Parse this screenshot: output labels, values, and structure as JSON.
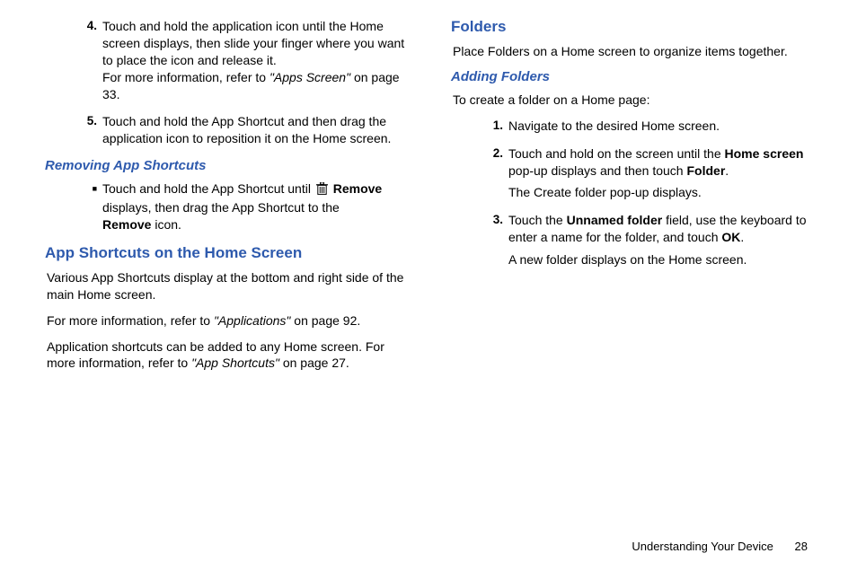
{
  "left": {
    "items45": [
      {
        "num": "4.",
        "body_a": "Touch and hold the application icon until the Home screen displays, then slide your finger where you want to place the icon and release it.",
        "body_b_pre": "For more information, refer to ",
        "body_b_ref": "\"Apps Screen\"",
        "body_b_post": " on page 33."
      },
      {
        "num": "5.",
        "body_a": "Touch and hold the App Shortcut and then drag the application icon to reposition it on the Home screen."
      }
    ],
    "h_removing": "Removing App Shortcuts",
    "remove_item": {
      "pre": "Touch and hold the App Shortcut until ",
      "remove_label": "Remove",
      "mid": " displays, then drag the App Shortcut to the ",
      "remove_icon_label": "Remove",
      "post": " icon."
    },
    "h_appshort": "App Shortcuts on the Home Screen",
    "p1": "Various App Shortcuts display at the bottom and right side of the main Home screen.",
    "p2_pre": "For more information, refer to ",
    "p2_ref": "\"Applications\"",
    "p2_post": " on page 92.",
    "p3_pre": "Application shortcuts can be added to any Home screen. For more information, refer to ",
    "p3_ref": "\"App Shortcuts\"",
    "p3_post": " on page 27."
  },
  "right": {
    "h_folders": "Folders",
    "p_intro": "Place Folders on a Home screen to organize items together.",
    "h_adding": "Adding Folders",
    "p_create": "To create a folder on a Home page:",
    "steps": [
      {
        "num": "1.",
        "a": "Navigate to the desired Home screen."
      },
      {
        "num": "2.",
        "a_pre": "Touch and hold on the screen until the ",
        "a_bold1": "Home screen",
        "a_mid": " pop-up displays and then touch ",
        "a_bold2": "Folder",
        "a_post": ".",
        "b": "The Create folder pop-up displays."
      },
      {
        "num": "3.",
        "a_pre": "Touch the ",
        "a_bold1": "Unnamed folder",
        "a_mid": " field, use the keyboard to enter a name for the folder, and touch ",
        "a_bold2": "OK",
        "a_post": ".",
        "b": "A new folder displays on the Home screen."
      }
    ]
  },
  "footer": {
    "section": "Understanding Your Device",
    "page": "28"
  }
}
